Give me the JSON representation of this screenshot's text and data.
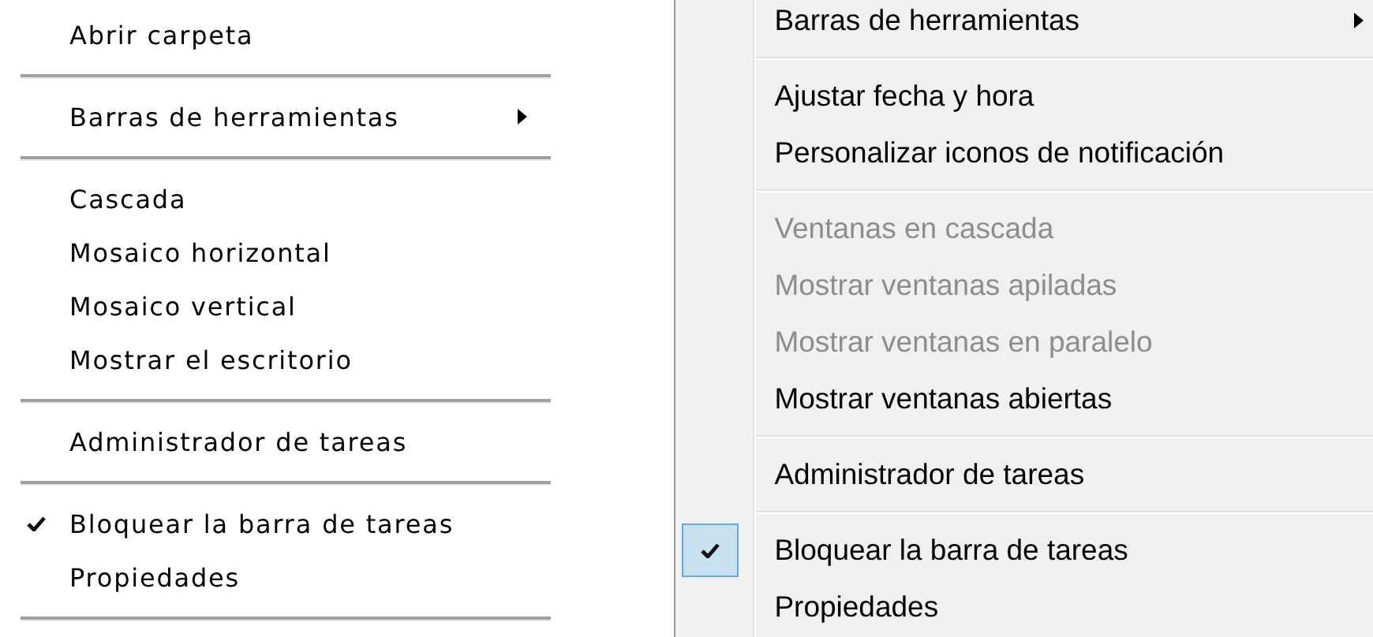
{
  "menus": [
    {
      "kind": "classic",
      "items": [
        {
          "kind": "item",
          "label": "Abrir carpeta",
          "checked": false,
          "disabled": false,
          "submenu": false
        },
        {
          "kind": "separator"
        },
        {
          "kind": "item",
          "label": "Barras de herramientas",
          "checked": false,
          "disabled": false,
          "submenu": true
        },
        {
          "kind": "separator"
        },
        {
          "kind": "item",
          "label": "Cascada",
          "checked": false,
          "disabled": false,
          "submenu": false
        },
        {
          "kind": "item",
          "label": "Mosaico horizontal",
          "checked": false,
          "disabled": false,
          "submenu": false
        },
        {
          "kind": "item",
          "label": "Mosaico vertical",
          "checked": false,
          "disabled": false,
          "submenu": false
        },
        {
          "kind": "item",
          "label": "Mostrar el escritorio",
          "checked": false,
          "disabled": false,
          "submenu": false
        },
        {
          "kind": "separator"
        },
        {
          "kind": "item",
          "label": "Administrador de tareas",
          "checked": false,
          "disabled": false,
          "submenu": false
        },
        {
          "kind": "separator"
        },
        {
          "kind": "item",
          "label": "Bloquear la barra de tareas",
          "checked": true,
          "disabled": false,
          "submenu": false
        },
        {
          "kind": "item",
          "label": "Propiedades",
          "checked": false,
          "disabled": false,
          "submenu": false
        },
        {
          "kind": "separator"
        }
      ]
    },
    {
      "kind": "modern",
      "items": [
        {
          "kind": "item",
          "label": "Barras de herramientas",
          "checked": false,
          "disabled": false,
          "submenu": true
        },
        {
          "kind": "separator"
        },
        {
          "kind": "item",
          "label": "Ajustar fecha y hora",
          "checked": false,
          "disabled": false,
          "submenu": false
        },
        {
          "kind": "item",
          "label": "Personalizar iconos de notificación",
          "checked": false,
          "disabled": false,
          "submenu": false
        },
        {
          "kind": "separator"
        },
        {
          "kind": "item",
          "label": "Ventanas en cascada",
          "checked": false,
          "disabled": true,
          "submenu": false
        },
        {
          "kind": "item",
          "label": "Mostrar ventanas apiladas",
          "checked": false,
          "disabled": true,
          "submenu": false
        },
        {
          "kind": "item",
          "label": "Mostrar ventanas en paralelo",
          "checked": false,
          "disabled": true,
          "submenu": false
        },
        {
          "kind": "item",
          "label": "Mostrar ventanas abiertas",
          "checked": false,
          "disabled": false,
          "submenu": false
        },
        {
          "kind": "separator"
        },
        {
          "kind": "item",
          "label": "Administrador de tareas",
          "checked": false,
          "disabled": false,
          "submenu": false
        },
        {
          "kind": "separator"
        },
        {
          "kind": "item",
          "label": "Bloquear la barra de tareas",
          "checked": true,
          "disabled": false,
          "submenu": false
        },
        {
          "kind": "item",
          "label": "Propiedades",
          "checked": false,
          "disabled": false,
          "submenu": false
        }
      ]
    }
  ]
}
